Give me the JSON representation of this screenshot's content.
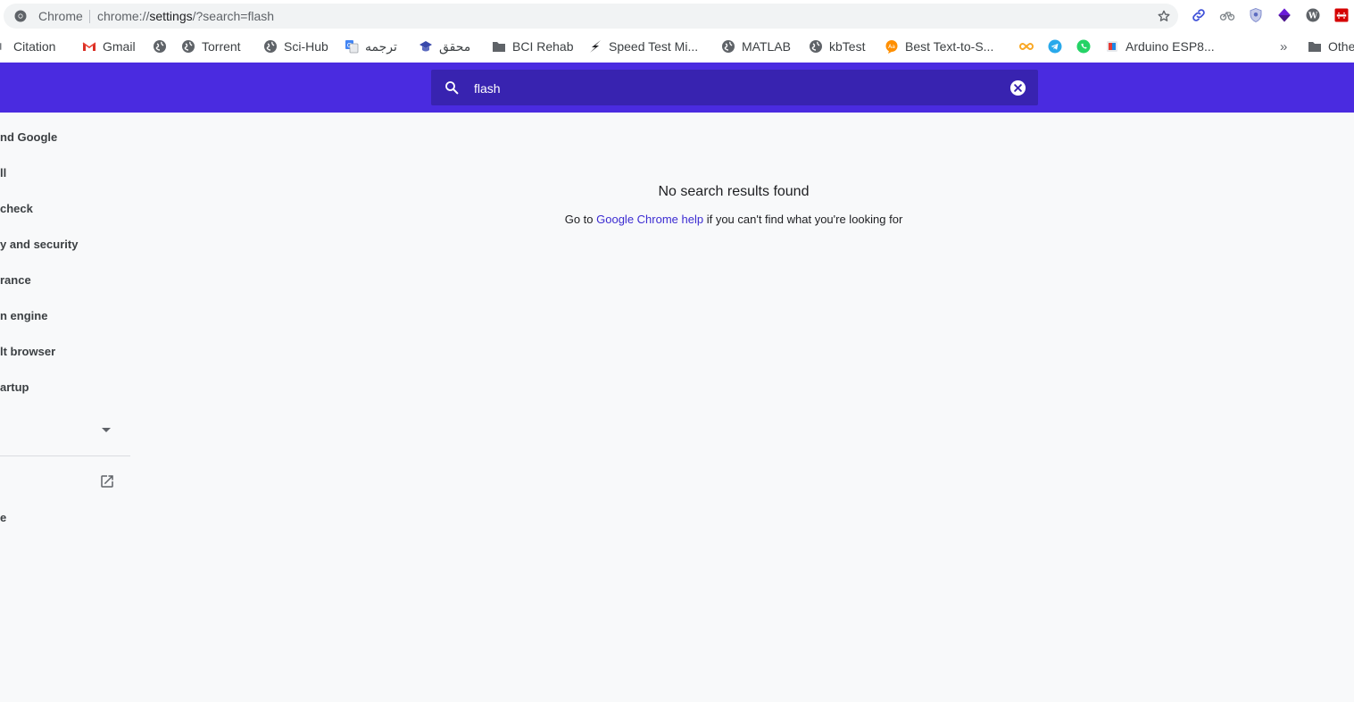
{
  "omnibox": {
    "site_label": "Chrome",
    "url_prefix": "chrome://",
    "url_host": "settings",
    "url_rest": "/?search=flash"
  },
  "bookmarks": [
    {
      "label": "Citation",
      "icon": "citation-icon"
    },
    {
      "label": "Gmail",
      "icon": "gmail-icon"
    },
    {
      "label": "",
      "icon": "globe-icon"
    },
    {
      "label": "Torrent",
      "icon": "globe-icon"
    },
    {
      "label": "Sci-Hub",
      "icon": "globe-icon"
    },
    {
      "label": "ترجمه",
      "icon": "translate-icon"
    },
    {
      "label": "محقق",
      "icon": "graduation-cap-icon"
    },
    {
      "label": "BCI Rehab",
      "icon": "folder-icon"
    },
    {
      "label": "Speed Test Mi...",
      "icon": "lightning-icon"
    },
    {
      "label": "MATLAB",
      "icon": "globe-icon"
    },
    {
      "label": "kbTest",
      "icon": "globe-icon"
    },
    {
      "label": "Best Text-to-S...",
      "icon": "text-to-speech-icon"
    },
    {
      "label": "",
      "icon": "infinity-icon"
    },
    {
      "label": "",
      "icon": "telegram-icon"
    },
    {
      "label": "",
      "icon": "whatsapp-icon"
    },
    {
      "label": "Arduino ESP8...",
      "icon": "arduino-icon"
    },
    {
      "label": "Othe",
      "icon": "folder-icon"
    }
  ],
  "search": {
    "value": "flash"
  },
  "sidebar": {
    "items": [
      {
        "label": "nd Google"
      },
      {
        "label": "ll"
      },
      {
        "label": "check"
      },
      {
        "label": "y and security"
      },
      {
        "label": "rance"
      },
      {
        "label": "n engine"
      },
      {
        "label": "lt browser"
      },
      {
        "label": "artup"
      },
      {
        "label": "e"
      }
    ]
  },
  "main": {
    "no_results_title": "No search results found",
    "help_prefix": "Go to ",
    "help_link": "Google Chrome help",
    "help_suffix": " if you can't find what you're looking for"
  },
  "colors": {
    "header": "#4a2be0",
    "search_box": "#3823b0",
    "link": "#3b2bd1",
    "page_bg": "#f8f9fa"
  }
}
